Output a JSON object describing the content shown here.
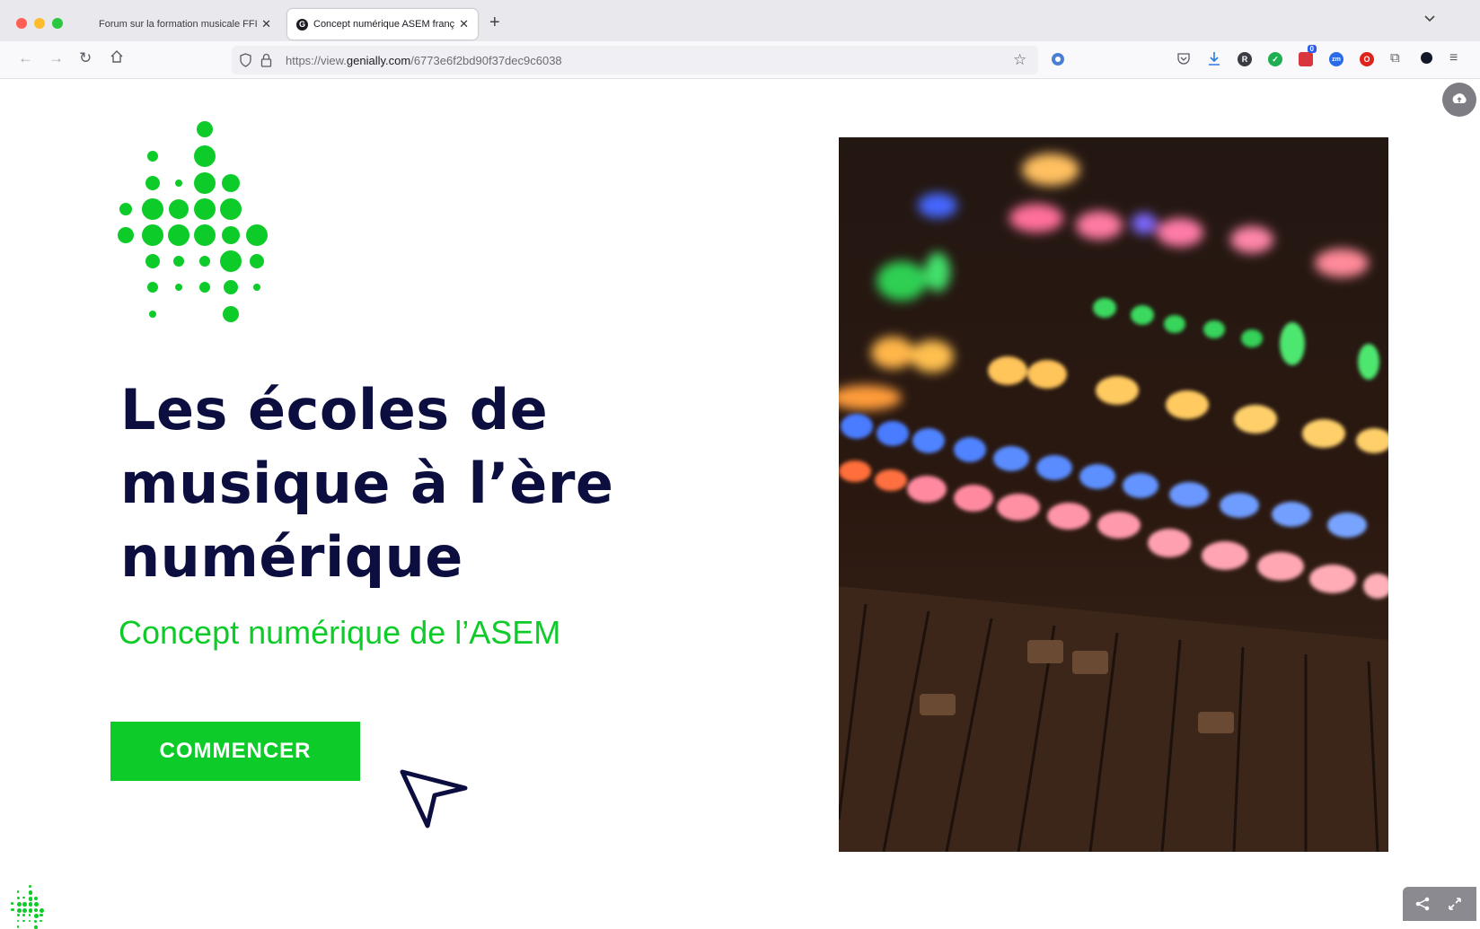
{
  "browser": {
    "tabs": [
      {
        "title": "Forum sur la formation musicale FFI",
        "active": false
      },
      {
        "title": "Concept numérique ASEM franç",
        "active": true
      }
    ],
    "url_prefix": "https://view.",
    "url_domain": "genially.com",
    "url_path": "/6773e6f2bd90f37dec9c6038",
    "extension_badge": "0"
  },
  "page": {
    "headline": "Les écoles de musique à l’ère numérique",
    "subtitle": "Concept numérique de l’ASEM",
    "start_label": "COMMENCER"
  },
  "colors": {
    "brand_green": "#0dcc29",
    "headline_navy": "#0b0e3f"
  }
}
